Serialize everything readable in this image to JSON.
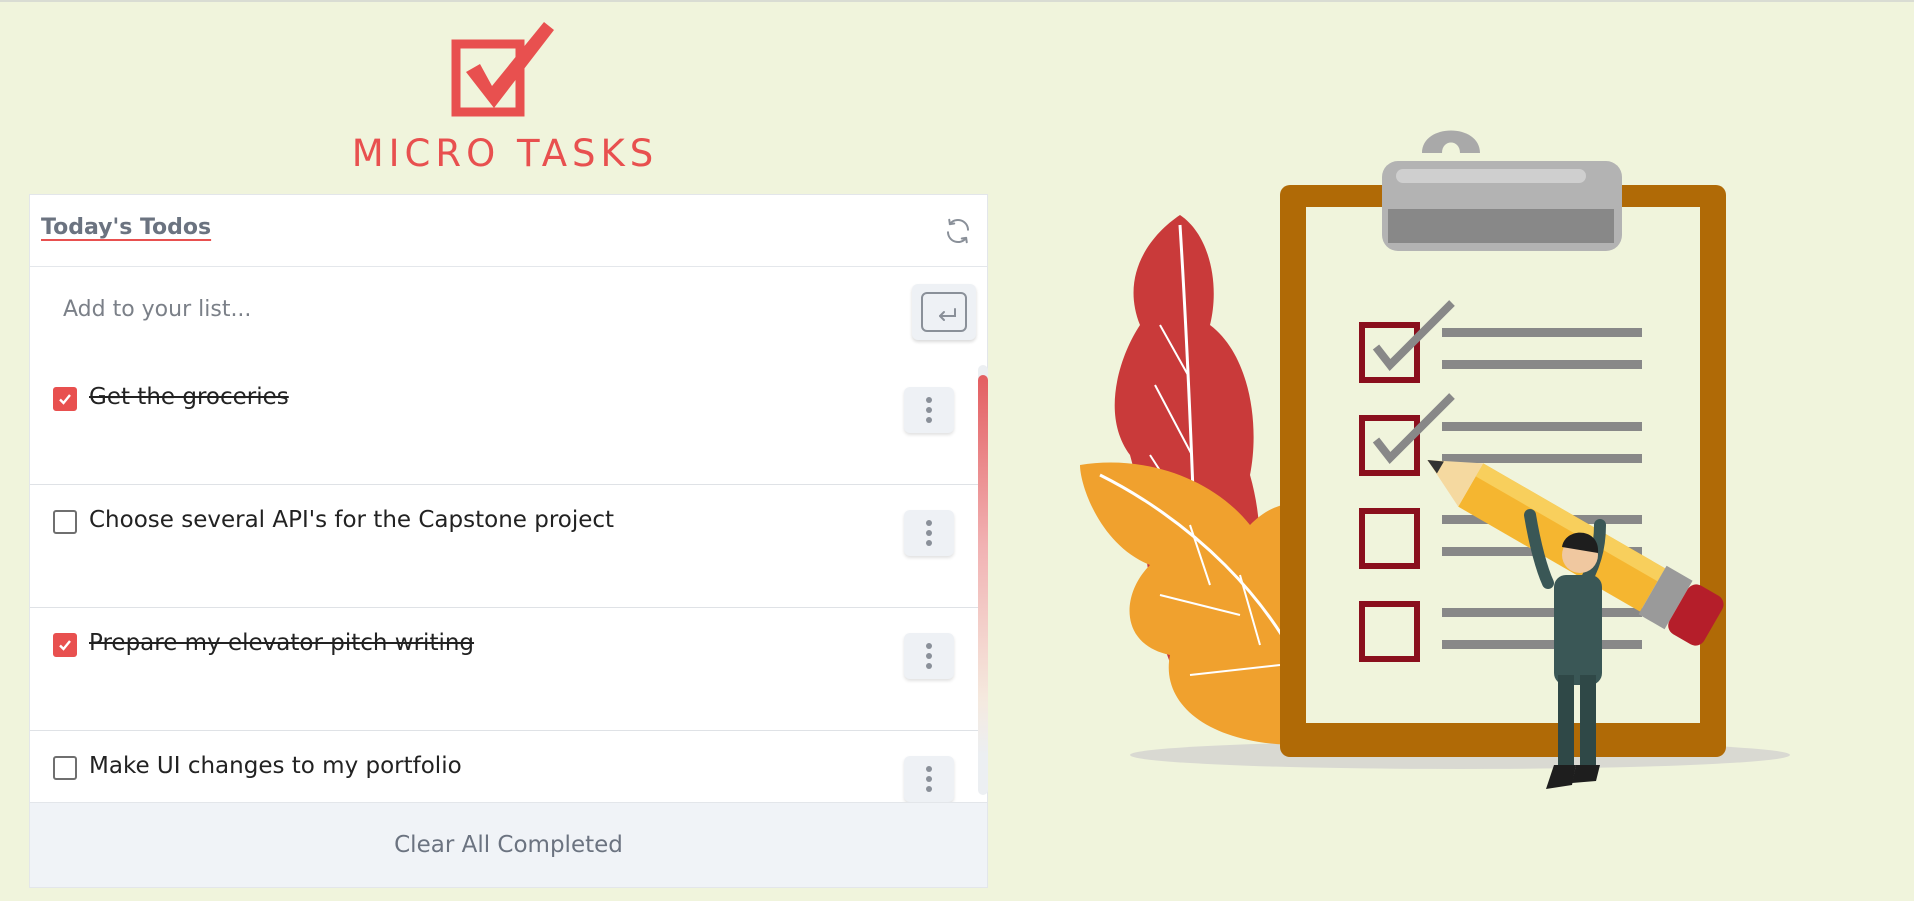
{
  "app": {
    "logo_text": "MICRO TASKS",
    "brand_color": "#e8504f",
    "background_color": "#f0f4dc"
  },
  "panel": {
    "title": "Today's Todos",
    "refresh_icon": "refresh-icon"
  },
  "add": {
    "placeholder": "Add to your list...",
    "value": "",
    "submit_icon": "enter-key-icon"
  },
  "todos": [
    {
      "text": "Get the groceries",
      "completed": true
    },
    {
      "text": "Choose several API's for the Capstone project",
      "completed": false
    },
    {
      "text": "Prepare my elevator pitch writing",
      "completed": true
    },
    {
      "text": "Make UI changes to my portfolio",
      "completed": false
    }
  ],
  "footer": {
    "clear_label": "Clear All Completed"
  }
}
